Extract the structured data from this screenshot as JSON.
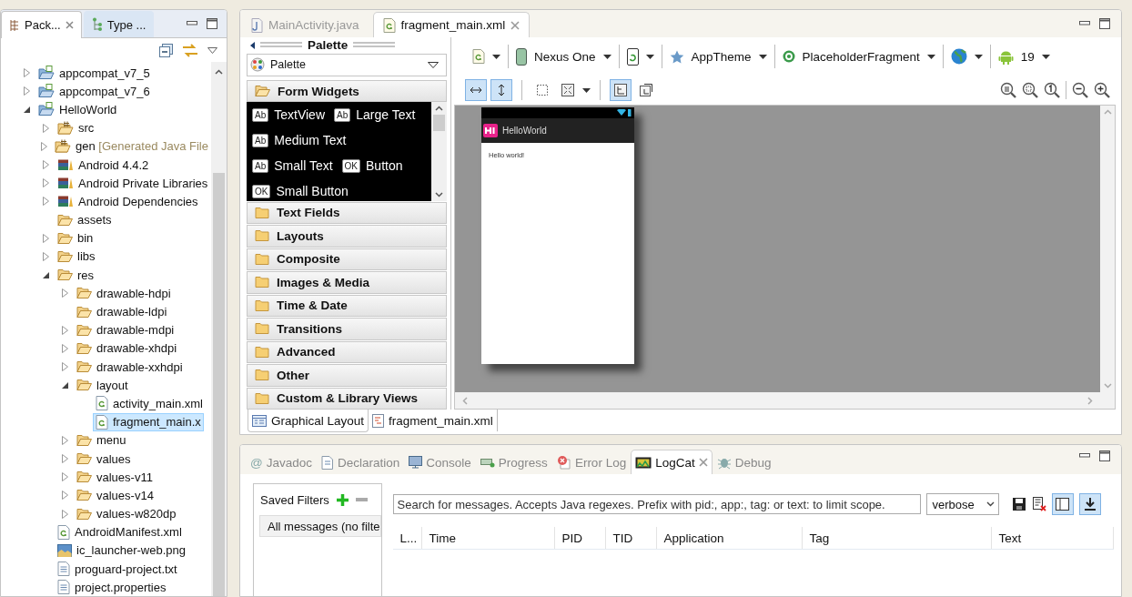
{
  "package_explorer": {
    "tabs": [
      {
        "label": "Pack...",
        "selected": true
      },
      {
        "label": "Type ...",
        "selected": false
      }
    ],
    "tree": [
      {
        "label": "appcompat_v7_5",
        "kind": "project",
        "expanded": false,
        "selected": false
      },
      {
        "label": "appcompat_v7_6",
        "kind": "project",
        "expanded": false,
        "selected": false
      },
      {
        "label": "HelloWorld",
        "kind": "project",
        "expanded": true,
        "selected": false,
        "children": [
          {
            "label": "src",
            "kind": "source-folder",
            "expanded": false,
            "selected": false
          },
          {
            "label": "gen",
            "decoration": "[Generated Java File",
            "kind": "source-folder",
            "expanded": false,
            "selected": false
          },
          {
            "label": "Android 4.4.2",
            "kind": "library",
            "expanded": false,
            "selected": false
          },
          {
            "label": "Android Private Libraries",
            "kind": "library",
            "expanded": false,
            "selected": false
          },
          {
            "label": "Android Dependencies",
            "kind": "library",
            "expanded": false,
            "selected": false
          },
          {
            "label": "assets",
            "kind": "folder",
            "selected": false
          },
          {
            "label": "bin",
            "kind": "folder",
            "expanded": false,
            "selected": false
          },
          {
            "label": "libs",
            "kind": "folder",
            "expanded": false,
            "selected": false
          },
          {
            "label": "res",
            "kind": "folder",
            "expanded": true,
            "selected": false,
            "children": [
              {
                "label": "drawable-hdpi",
                "kind": "folder",
                "expanded": false,
                "selected": false
              },
              {
                "label": "drawable-ldpi",
                "kind": "folder",
                "selected": false
              },
              {
                "label": "drawable-mdpi",
                "kind": "folder",
                "expanded": false,
                "selected": false
              },
              {
                "label": "drawable-xhdpi",
                "kind": "folder",
                "expanded": false,
                "selected": false
              },
              {
                "label": "drawable-xxhdpi",
                "kind": "folder",
                "expanded": false,
                "selected": false
              },
              {
                "label": "layout",
                "kind": "folder",
                "expanded": true,
                "selected": false,
                "children": [
                  {
                    "label": "activity_main.xml",
                    "kind": "xml-file",
                    "selected": false
                  },
                  {
                    "label": "fragment_main.x",
                    "kind": "xml-file",
                    "selected": true
                  }
                ]
              },
              {
                "label": "menu",
                "kind": "folder",
                "expanded": false,
                "selected": false
              },
              {
                "label": "values",
                "kind": "folder",
                "expanded": false,
                "selected": false
              },
              {
                "label": "values-v11",
                "kind": "folder",
                "expanded": false,
                "selected": false
              },
              {
                "label": "values-v14",
                "kind": "folder",
                "expanded": false,
                "selected": false
              },
              {
                "label": "values-w820dp",
                "kind": "folder",
                "expanded": false,
                "selected": false
              }
            ]
          },
          {
            "label": "AndroidManifest.xml",
            "kind": "xml-file",
            "selected": false
          },
          {
            "label": "ic_launcher-web.png",
            "kind": "image-file",
            "selected": false
          },
          {
            "label": "proguard-project.txt",
            "kind": "text-file",
            "selected": false
          },
          {
            "label": "project.properties",
            "kind": "text-file",
            "selected": false
          }
        ]
      }
    ]
  },
  "editor": {
    "tabs": [
      {
        "label": "MainActivity.java",
        "selected": false
      },
      {
        "label": "fragment_main.xml",
        "selected": true
      }
    ],
    "palette": {
      "title": "Palette",
      "selector": "Palette",
      "categories": [
        {
          "label": "Form Widgets",
          "expanded": true,
          "items": [
            {
              "badge": "Ab",
              "label": "TextView"
            },
            {
              "badge": "Ab",
              "label": "Large Text"
            },
            {
              "badge": "Ab",
              "label": "Medium Text"
            },
            {
              "badge": "Ab",
              "label": "Small Text"
            },
            {
              "badge": "OK",
              "label": "Button"
            },
            {
              "badge": "OK",
              "label": "Small Button"
            }
          ]
        },
        {
          "label": "Text Fields",
          "expanded": false
        },
        {
          "label": "Layouts",
          "expanded": false
        },
        {
          "label": "Composite",
          "expanded": false
        },
        {
          "label": "Images & Media",
          "expanded": false
        },
        {
          "label": "Time & Date",
          "expanded": false
        },
        {
          "label": "Transitions",
          "expanded": false
        },
        {
          "label": "Advanced",
          "expanded": false
        },
        {
          "label": "Other",
          "expanded": false
        },
        {
          "label": "Custom & Library Views",
          "expanded": false
        }
      ]
    },
    "config_bar": [
      {
        "kind": "layout-file"
      },
      {
        "kind": "device",
        "label": "Nexus One"
      },
      {
        "kind": "orientation"
      },
      {
        "kind": "theme",
        "label": "AppTheme"
      },
      {
        "kind": "activity",
        "label": "PlaceholderFragment"
      },
      {
        "kind": "locale"
      },
      {
        "kind": "api",
        "label": "19"
      }
    ],
    "view_toggles": [
      {
        "kind": "fit-width",
        "selected": true
      },
      {
        "kind": "fit-height",
        "selected": true
      },
      {
        "kind": "margins",
        "selected": false
      },
      {
        "kind": "resize",
        "selected": false
      },
      {
        "kind": "structure",
        "selected": true
      },
      {
        "kind": "clip",
        "selected": false
      }
    ],
    "device_preview": {
      "app_title": "HelloWorld",
      "text": "Hello world!"
    },
    "view_tabs": [
      {
        "label": "Graphical Layout",
        "selected": true
      },
      {
        "label": "fragment_main.xml",
        "selected": false
      }
    ]
  },
  "bottom_panel": {
    "tabs": [
      {
        "label": "Javadoc",
        "glyph": "@",
        "selected": false
      },
      {
        "label": "Declaration",
        "selected": false
      },
      {
        "label": "Console",
        "selected": false
      },
      {
        "label": "Progress",
        "selected": false
      },
      {
        "label": "Error Log",
        "selected": false
      },
      {
        "label": "LogCat",
        "selected": true
      },
      {
        "label": "Debug",
        "selected": false
      }
    ],
    "saved_filters": {
      "title": "Saved Filters",
      "items": [
        {
          "label": "All messages (no filte",
          "selected": true
        }
      ]
    },
    "search": {
      "placeholder": "Search for messages. Accepts Java regexes. Prefix with pid:, app:, tag: or text: to limit scope."
    },
    "log_level": "verbose",
    "toggles": [
      {
        "selected": true
      },
      {
        "selected": true
      }
    ],
    "columns": [
      "L...",
      "Time",
      "PID",
      "TID",
      "Application",
      "Tag",
      "Text"
    ]
  }
}
